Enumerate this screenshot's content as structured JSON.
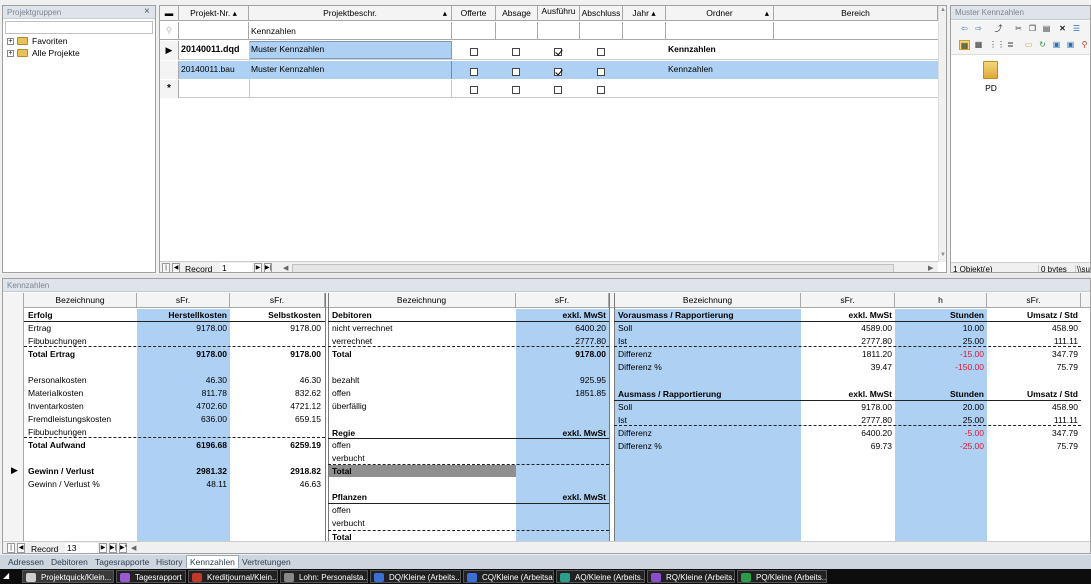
{
  "projektgruppen": {
    "title": "Projektgruppen",
    "close": "×",
    "tree": [
      {
        "label": "Favoriten"
      },
      {
        "label": "Alle Projekte"
      }
    ]
  },
  "grid": {
    "columns": [
      "Projekt-Nr.",
      "Projektbeschr.",
      "Offerte",
      "Absage",
      "Ausführu",
      "Abschluss",
      "Jahr",
      "Ordner",
      "Bereich"
    ],
    "filter": {
      "projektbeschr": "Kennzahlen"
    },
    "rows": [
      {
        "nr": "20140011.dqd",
        "beschr": "Muster Kennzahlen",
        "offerte": false,
        "absage": false,
        "ausfuehrung": true,
        "abschluss": false,
        "ordner": "Kennzahlen"
      },
      {
        "nr": "20140011.bau",
        "beschr": "Muster Kennzahlen",
        "offerte": false,
        "absage": false,
        "ausfuehrung": true,
        "abschluss": false,
        "ordner": "Kennzahlen"
      }
    ],
    "new_row_marker": "*",
    "record_label": "Record",
    "record_value": "1"
  },
  "explorer": {
    "title": "Muster Kennzahlen",
    "folder_label": "PD",
    "status_count": "1 Objekt(e)",
    "status_size": "0 bytes",
    "status_path": "\\\\su"
  },
  "kennzahlen": {
    "title": "Kennzahlen",
    "record_label": "Record",
    "record_value": "13",
    "erfolg": {
      "headers": [
        "Bezeichnung",
        "sFr.",
        "sFr."
      ],
      "section": "Erfolg",
      "col1": "Herstellkosten",
      "col2": "Selbstkosten",
      "rows": [
        {
          "label": "Ertrag",
          "v1": "9178.00",
          "v2": "9178.00",
          "bold": false
        },
        {
          "label": "Fibubuchungen",
          "v1": "",
          "v2": "",
          "bold": false
        },
        {
          "label": "Total Ertrag",
          "v1": "9178.00",
          "v2": "9178.00",
          "bold": true
        },
        {
          "label": "",
          "v1": "",
          "v2": "",
          "bold": false
        },
        {
          "label": "Personalkosten",
          "v1": "46.30",
          "v2": "46.30",
          "bold": false
        },
        {
          "label": "Materialkosten",
          "v1": "811.78",
          "v2": "832.62",
          "bold": false
        },
        {
          "label": "Inventarkosten",
          "v1": "4702.60",
          "v2": "4721.12",
          "bold": false
        },
        {
          "label": "Fremdleistungskosten",
          "v1": "636.00",
          "v2": "659.15",
          "bold": false
        },
        {
          "label": "Fibubuchungen",
          "v1": "",
          "v2": "",
          "bold": false
        },
        {
          "label": "Total Aufwand",
          "v1": "6196.68",
          "v2": "6259.19",
          "bold": true
        },
        {
          "label": "",
          "v1": "",
          "v2": "",
          "bold": false
        },
        {
          "label": "Gewinn / Verlust",
          "v1": "2981.32",
          "v2": "2918.82",
          "bold": true
        },
        {
          "label": "Gewinn / Verlust %",
          "v1": "48.11",
          "v2": "46.63",
          "bold": false
        }
      ]
    },
    "debitoren": {
      "headers": [
        "Bezeichnung",
        "sFr."
      ],
      "section": "Debitoren",
      "unit": "exkl. MwSt",
      "rows": [
        {
          "label": "nicht verrechnet",
          "v": "6400.20"
        },
        {
          "label": "verrechnet",
          "v": "2777.80"
        },
        {
          "label": "Total",
          "v": "9178.00"
        },
        {
          "label": "",
          "v": ""
        },
        {
          "label": "bezahlt",
          "v": "925.95"
        },
        {
          "label": "offen",
          "v": "1851.85"
        },
        {
          "label": "überfällig",
          "v": ""
        }
      ],
      "regie": {
        "section": "Regie",
        "unit": "exkl. MwSt",
        "rows": [
          "offen",
          "verbucht"
        ],
        "total": "Total"
      },
      "pflanzen": {
        "section": "Pflanzen",
        "unit": "exkl. MwSt",
        "rows": [
          "offen",
          "verbucht"
        ],
        "total": "Total"
      }
    },
    "vorausmass": {
      "headers": [
        "Bezeichnung",
        "sFr.",
        "h",
        "sFr."
      ],
      "section": "Vorausmass / Rapportierung",
      "units": [
        "exkl. MwSt",
        "Stunden",
        "Umsatz / Std"
      ],
      "rows": [
        {
          "label": "Soll",
          "a": "4589.00",
          "b": "10.00",
          "c": "458.90",
          "neg": false
        },
        {
          "label": "Ist",
          "a": "2777.80",
          "b": "25.00",
          "c": "111.11",
          "neg": false
        },
        {
          "label": "Differenz",
          "a": "1811.20",
          "b": "-15.00",
          "c": "347.79",
          "neg": true
        },
        {
          "label": "Differenz %",
          "a": "39.47",
          "b": "-150.00",
          "c": "75.79",
          "neg": true
        }
      ],
      "section2": "Ausmass / Rapportierung",
      "rows2": [
        {
          "label": "Soll",
          "a": "9178.00",
          "b": "20.00",
          "c": "458.90",
          "neg": false
        },
        {
          "label": "Ist",
          "a": "2777.80",
          "b": "25.00",
          "c": "111.11",
          "neg": false
        },
        {
          "label": "Differenz",
          "a": "6400.20",
          "b": "-5.00",
          "c": "347.79",
          "neg": true
        },
        {
          "label": "Differenz %",
          "a": "69.73",
          "b": "-25.00",
          "c": "75.79",
          "neg": true
        }
      ]
    }
  },
  "tabs": [
    "Adressen",
    "Debitoren",
    "Tagesrapporte",
    "History",
    "Kennzahlen",
    "Vertretungen"
  ],
  "active_tab": "Kennzahlen",
  "taskbar": [
    {
      "label": "Projektquick/Klein...",
      "color": "#cfcfcf"
    },
    {
      "label": "Tagesrapport",
      "color": "#9b59d0"
    },
    {
      "label": "Kreditjournal/Klein...",
      "color": "#c0392b"
    },
    {
      "label": "Lohn: Personalsta...",
      "color": "#888888"
    },
    {
      "label": "DQ/Kleine (Arbeits...",
      "color": "#3b6fd6"
    },
    {
      "label": "CQ/Kleine (Arbeitsa...",
      "color": "#3b6fd6"
    },
    {
      "label": "AQ/Kleine (Arbeits...",
      "color": "#2aa08a"
    },
    {
      "label": "RQ/Kleine (Arbeits...",
      "color": "#8a4fc7"
    },
    {
      "label": "PQ/Kleine (Arbeits...",
      "color": "#2a9d4a"
    }
  ],
  "colors": {
    "selected_row": "#add0f3",
    "negative": "#e0162b",
    "panel_header": "#dfe3ea"
  }
}
